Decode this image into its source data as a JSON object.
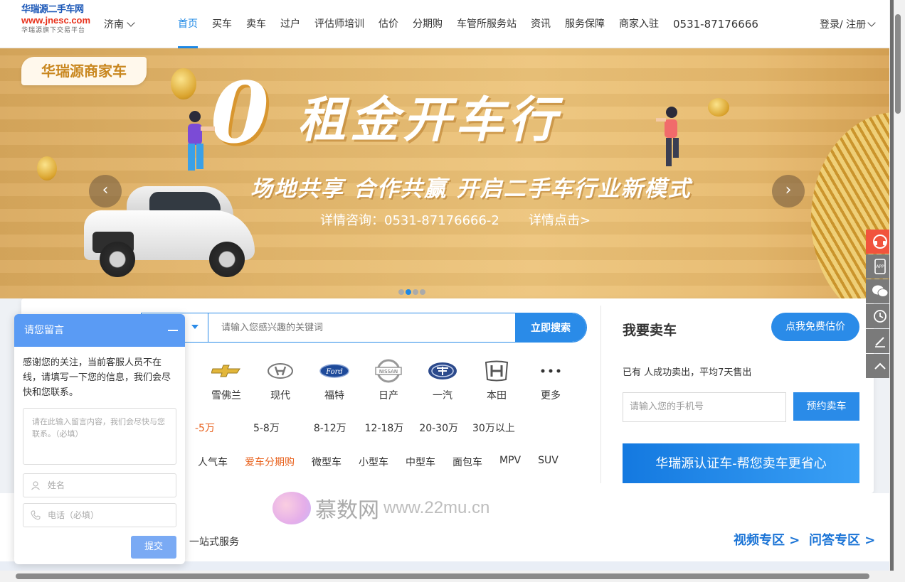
{
  "header": {
    "logo": {
      "title": "华瑞源二手车网",
      "url": "www.jnesc.com",
      "subtitle": "华瑞源旗下交易平台"
    },
    "city": "济南",
    "nav": [
      "首页",
      "买车",
      "卖车",
      "过户",
      "评估师培训",
      "估价",
      "分期购",
      "车管所服务站",
      "资讯",
      "服务保障",
      "商家入驻"
    ],
    "active_nav": "首页",
    "phone": "0531-87176666",
    "login": "登录/ 注册"
  },
  "banner": {
    "tag": "华瑞源商家车",
    "zero": "0",
    "title": "租金开车行",
    "subtitle": "场地共享  合作共赢  开启二手车行业新模式",
    "contact": "详情咨询：0531-87176666-2",
    "detail_link": "详情点击>",
    "prev": "‹",
    "next": "›",
    "slide_count": 4,
    "active_slide": 1
  },
  "search": {
    "placeholder": "请输入您感兴趣的关键词",
    "button": "立即搜索",
    "brands": [
      "雪佛兰",
      "现代",
      "福特",
      "日产",
      "一汽",
      "本田",
      "更多"
    ],
    "prices": [
      "-5万",
      "5-8万",
      "8-12万",
      "12-18万",
      "20-30万",
      "30万以上"
    ],
    "types": [
      "人气车",
      "爱车分期购",
      "微型车",
      "小型车",
      "中型车",
      "面包车",
      "MPV",
      "SUV"
    ]
  },
  "sell": {
    "title": "我要卖车",
    "estimate_button": "点我免费估价",
    "stat": "已有 人成功卖出，平均7天售出",
    "phone_placeholder": "请输入您的手机号",
    "book_button": "预约卖车",
    "cert_banner": "华瑞源认证车-帮您卖车更省心"
  },
  "bottom": {
    "service": "一站式服务",
    "video_link": "视频专区 >",
    "qa_link": "问答专区 >"
  },
  "watermark": {
    "cn": "慕数网",
    "en": "www.22mu.cn"
  },
  "chat": {
    "title": "请您留言",
    "message": "感谢您的关注，当前客服人员不在线，请填写一下您的信息，我们会尽快和您联系。",
    "textarea_placeholder": "请在此输入留言内容，我们会尽快与您联系。（必填）",
    "name_placeholder": "姓名",
    "phone_placeholder": "电话（必填）",
    "submit": "提交"
  },
  "float_bar": [
    "customer-service-icon",
    "app-icon",
    "wechat-icon",
    "history-icon",
    "edit-icon",
    "back-to-top-icon"
  ],
  "colors": {
    "accent": "#1e88e5",
    "highlight": "#e8601b",
    "chat_header": "#5a9bf4",
    "float_red": "#f1533d"
  }
}
